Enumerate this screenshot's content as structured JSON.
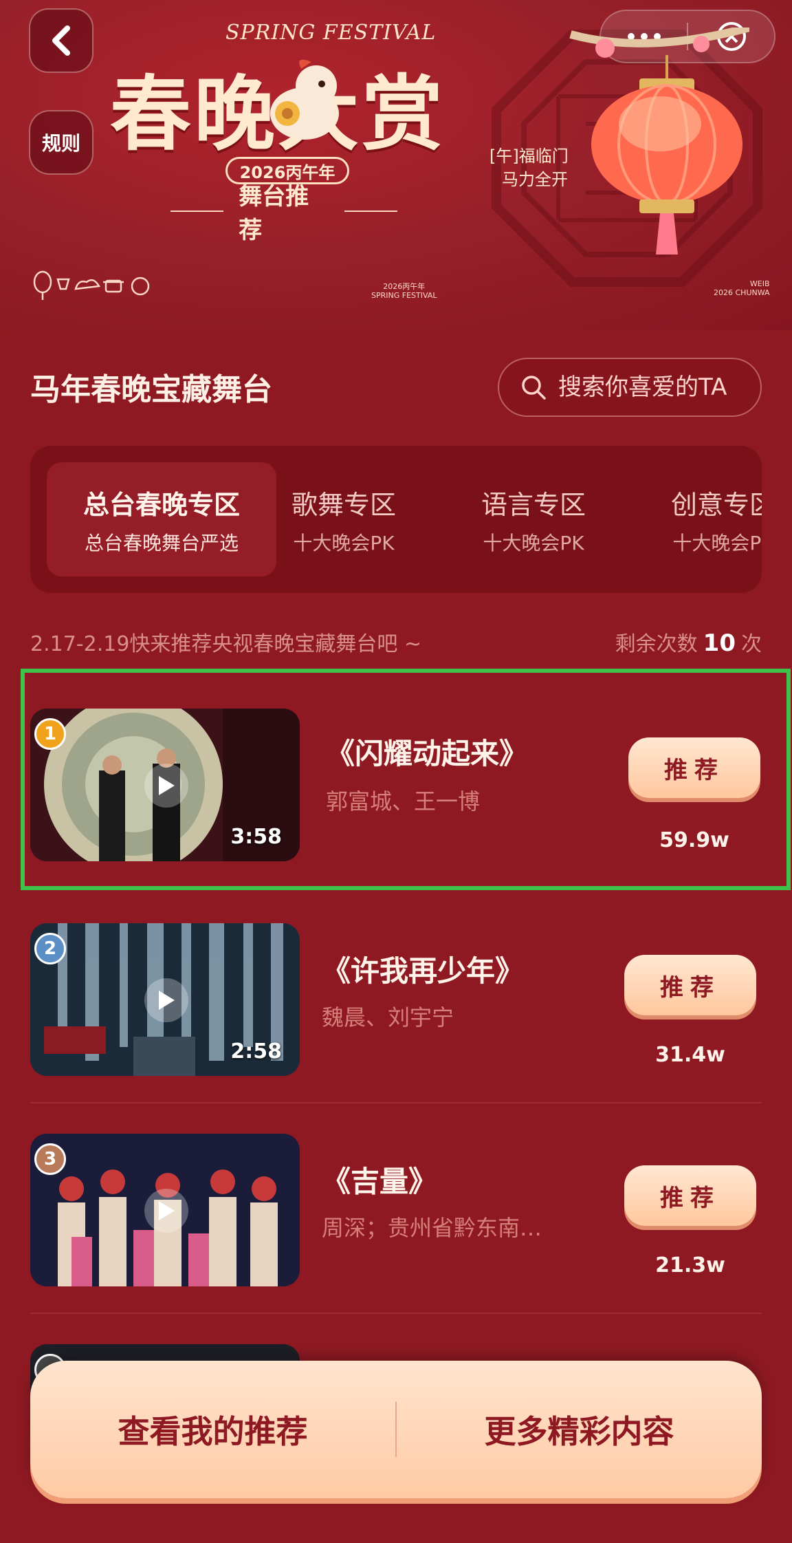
{
  "header": {
    "back_label": "<",
    "rules_label": "规则",
    "more_icon": "more-dots-icon",
    "close_icon": "close-circle-icon",
    "spring_word": "SPRING FESTIVAL",
    "weibo_mark": "WEIBO",
    "year_mark": "2026",
    "title": "春晚大赏",
    "year_pill": "2026丙午年",
    "subtitle": "舞台推荐",
    "lantern_line1": "[午]福临门",
    "lantern_line2": "马力全开",
    "logo_center_top": "2026丙午年",
    "logo_center_bottom": "SPRING FESTIVAL",
    "logo_right_top": "WEIB",
    "logo_right_bottom": "2026 CHUNWA"
  },
  "section": {
    "title": "马年春晚宝藏舞台",
    "search_placeholder": "搜索你喜爱的TA"
  },
  "tabs": [
    {
      "title": "总台春晚专区",
      "subtitle": "总台春晚舞台严选",
      "active": true
    },
    {
      "title": "歌舞专区",
      "subtitle": "十大晚会PK",
      "active": false
    },
    {
      "title": "语言专区",
      "subtitle": "十大晚会PK",
      "active": false
    },
    {
      "title": "创意专区",
      "subtitle": "十大晚会PK",
      "active": false
    }
  ],
  "info": {
    "notice": "2.17-2.19快来推荐央视春晚宝藏舞台吧 ~",
    "remaining_prefix": "剩余次数",
    "remaining_count": "10",
    "remaining_suffix": "次"
  },
  "items": [
    {
      "rank": "1",
      "title": "《闪耀动起来》",
      "artist": "郭富城、王一博",
      "duration": "3:58",
      "button": "推荐",
      "votes": "59.9w",
      "rank_color": "#f0a21c"
    },
    {
      "rank": "2",
      "title": "《许我再少年》",
      "artist": "魏晨、刘宇宁",
      "duration": "2:58",
      "button": "推荐",
      "votes": "31.4w",
      "rank_color": "#5b8fc6"
    },
    {
      "rank": "3",
      "title": "《吉量》",
      "artist": "周深；贵州省黔东南…",
      "duration": "",
      "button": "推荐",
      "votes": "21.3w",
      "rank_color": "#b97a5a"
    }
  ],
  "bottom": {
    "my_recs": "查看我的推荐",
    "more": "更多精彩内容"
  },
  "colors": {
    "background": "#8f1a22",
    "button_gradient_top": "#ffe7d2",
    "button_gradient_bottom": "#ffc79d",
    "highlight_border": "#3ec24a"
  }
}
